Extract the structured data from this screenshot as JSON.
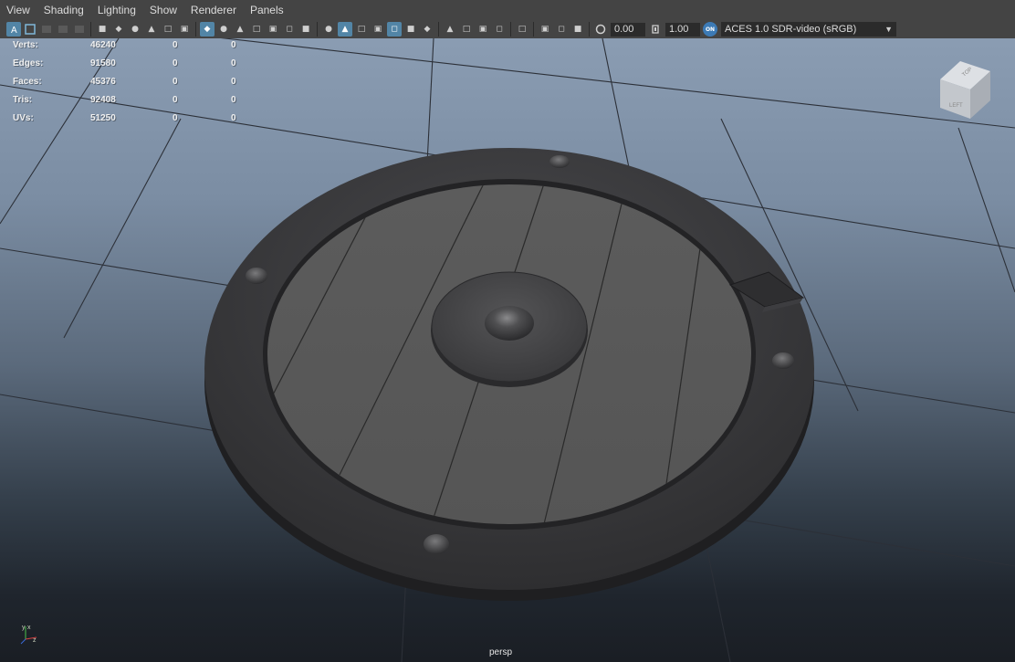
{
  "menu": [
    "View",
    "Shading",
    "Lighting",
    "Show",
    "Renderer",
    "Panels"
  ],
  "toolbar": {
    "groups": [
      [
        "select-camera-icon",
        "camera-attributes-icon",
        "bookmark-icon",
        "image-plane-icon",
        "2d-pan-zoom-icon",
        "grease-pencil-icon"
      ],
      [
        "grid-icon",
        "film-gate-icon",
        "resolution-gate-icon",
        "gate-mask-icon",
        "field-chart-icon",
        "safe-action-icon",
        "safe-title-icon"
      ],
      [
        "wireframe-icon",
        "smooth-shade-icon",
        "wireframe-on-shaded-icon",
        "default-material-icon",
        "textured-icon",
        "use-all-lights-icon",
        "shadows-icon"
      ],
      [
        "screen-space-ao-icon",
        "motion-blur-icon",
        "multisample-aa-icon",
        "depth-of-field-icon"
      ],
      [
        "isolate-select-icon"
      ],
      [
        "xray-icon",
        "xray-active-components-icon",
        "xray-joints-icon"
      ]
    ],
    "exposure": "0.00",
    "gamma": "1.00",
    "color_management_badge": "ON",
    "color_space": "ACES 1.0 SDR-video (sRGB)"
  },
  "hud": {
    "rows": [
      {
        "label": "Verts:",
        "v1": "46240",
        "v2": "0",
        "v3": "0"
      },
      {
        "label": "Edges:",
        "v1": "91580",
        "v2": "0",
        "v3": "0"
      },
      {
        "label": "Faces:",
        "v1": "45376",
        "v2": "0",
        "v3": "0"
      },
      {
        "label": "Tris:",
        "v1": "92408",
        "v2": "0",
        "v3": "0"
      },
      {
        "label": "UVs:",
        "v1": "51250",
        "v2": "0",
        "v3": "0"
      }
    ]
  },
  "view_cube": {
    "top": "TOP",
    "left": "LEFT"
  },
  "axis_indicator": {
    "y": "y",
    "x": "x",
    "z": "z"
  },
  "camera_name": "persp",
  "colors": {
    "menu_bg": "#444444",
    "active_icon": "#5285a6",
    "shield_rim": "#3a3a3c",
    "shield_face": "#595959",
    "boss": "#4a4a4c"
  }
}
